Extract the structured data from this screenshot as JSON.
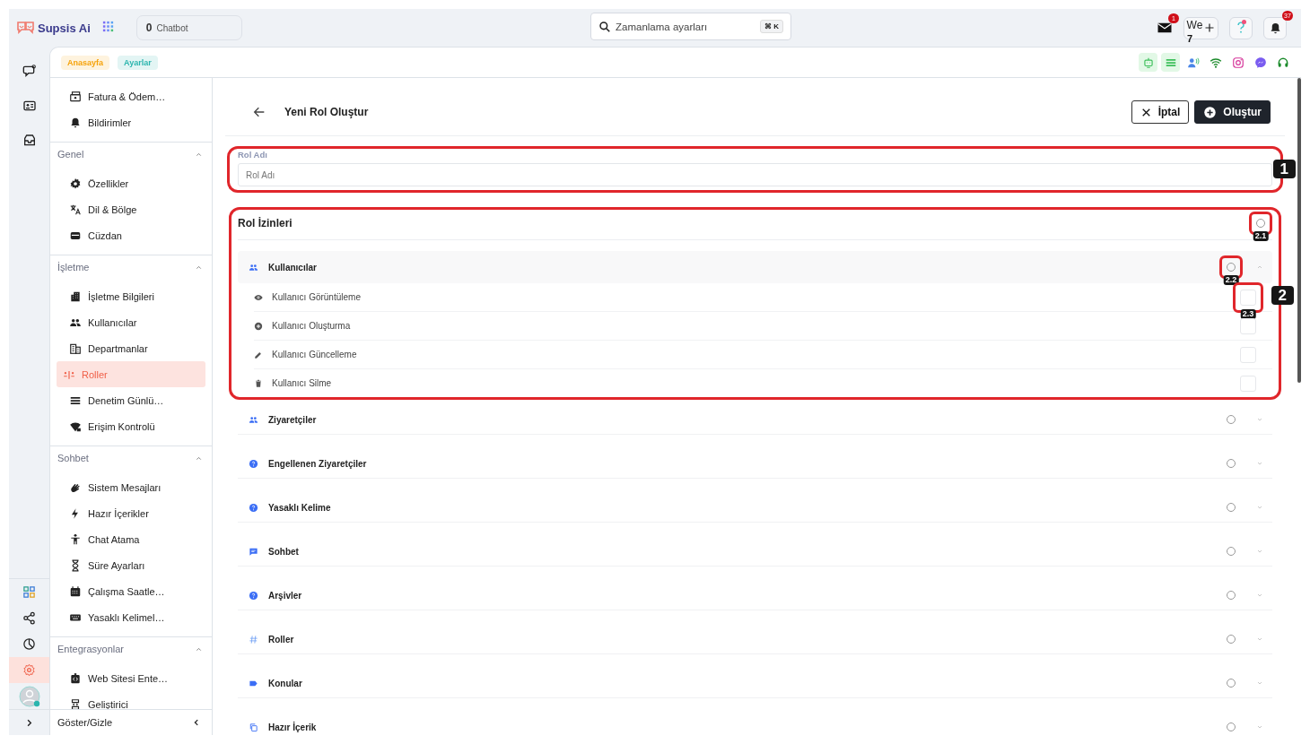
{
  "top_bar": {
    "brand": "Supsis Ai",
    "chatbot": {
      "count": "0",
      "label": "Chatbot"
    },
    "search": {
      "value": "Zamanlama ayarları",
      "shortcut": "⌘ K"
    },
    "mail_badge": "1",
    "workspace": {
      "label": "We",
      "count": "7"
    },
    "notification_badge": "37"
  },
  "rail": {
    "top": [
      {
        "selected": false
      },
      {
        "selected": false
      },
      {
        "selected": false
      }
    ],
    "bottom": [
      {
        "selected": false
      },
      {
        "selected": false
      },
      {
        "selected": false
      },
      {
        "selected": true
      }
    ]
  },
  "breadcrumbs": [
    {
      "label": "Anasayfa",
      "color": "#f5a20a"
    },
    {
      "label": "Ayarlar",
      "color": "#2bb5ae"
    }
  ],
  "sidebar": {
    "sections": [
      {
        "items": [
          {
            "label": "Fatura & Ödem…",
            "selected": false
          },
          {
            "label": "Bildirimler",
            "selected": false
          }
        ]
      },
      {
        "title": "Genel",
        "expanded": true,
        "items": [
          {
            "label": "Özellikler",
            "selected": false
          },
          {
            "label": "Dil & Bölge",
            "selected": false
          },
          {
            "label": "Cüzdan",
            "selected": false
          }
        ]
      },
      {
        "title": "İşletme",
        "expanded": true,
        "items": [
          {
            "label": "İşletme Bilgileri",
            "selected": false
          },
          {
            "label": "Kullanıcılar",
            "selected": false
          },
          {
            "label": "Departmanlar",
            "selected": false
          },
          {
            "label": "Roller",
            "selected": true
          },
          {
            "label": "Denetim Günlü…",
            "selected": false
          },
          {
            "label": "Erişim Kontrolü",
            "selected": false
          }
        ]
      },
      {
        "title": "Sohbet",
        "expanded": true,
        "items": [
          {
            "label": "Sistem Mesajları",
            "selected": false
          },
          {
            "label": "Hazır İçerikler",
            "selected": false
          },
          {
            "label": "Chat Atama",
            "selected": false
          },
          {
            "label": "Süre Ayarları",
            "selected": false
          },
          {
            "label": "Çalışma Saatle…",
            "selected": false
          },
          {
            "label": "Yasaklı Kelimel…",
            "selected": false
          }
        ]
      },
      {
        "title": "Entegrasyonlar",
        "expanded": true,
        "items": [
          {
            "label": "Web Sitesi Ente…",
            "selected": false
          },
          {
            "label": "Geliştirici",
            "selected": false
          }
        ]
      }
    ],
    "footer": "Göster/Gizle"
  },
  "content": {
    "title": "Yeni Rol Oluştur",
    "cancel": "İptal",
    "create": "Oluştur",
    "form": {
      "label": "Rol Adı",
      "placeholder": "Rol Adı",
      "callout": "1"
    },
    "permissions": {
      "title": "Rol İzinleri",
      "callout": "2",
      "all_selected": false,
      "all_callout": "2.1",
      "groups": [
        {
          "name": "Kullanıcılar",
          "selected": false,
          "expanded": true,
          "callout": "2.2",
          "permissions": [
            {
              "name": "Kullanıcı Görüntüleme",
              "checked": false,
              "callout": "2.3"
            },
            {
              "name": "Kullanıcı Oluşturma",
              "checked": false
            },
            {
              "name": "Kullanıcı Güncelleme",
              "checked": false
            },
            {
              "name": "Kullanıcı Silme",
              "checked": false
            }
          ]
        },
        {
          "name": "Ziyaretçiler",
          "selected": false,
          "expanded": false
        },
        {
          "name": "Engellenen Ziyaretçiler",
          "selected": false,
          "expanded": false
        },
        {
          "name": "Yasaklı Kelime",
          "selected": false,
          "expanded": false
        },
        {
          "name": "Sohbet",
          "selected": false,
          "expanded": false
        },
        {
          "name": "Arşivler",
          "selected": false,
          "expanded": false
        },
        {
          "name": "Roller",
          "selected": false,
          "expanded": false
        },
        {
          "name": "Konular",
          "selected": false,
          "expanded": false
        },
        {
          "name": "Hazır İçerik",
          "selected": false,
          "expanded": false
        }
      ]
    }
  }
}
